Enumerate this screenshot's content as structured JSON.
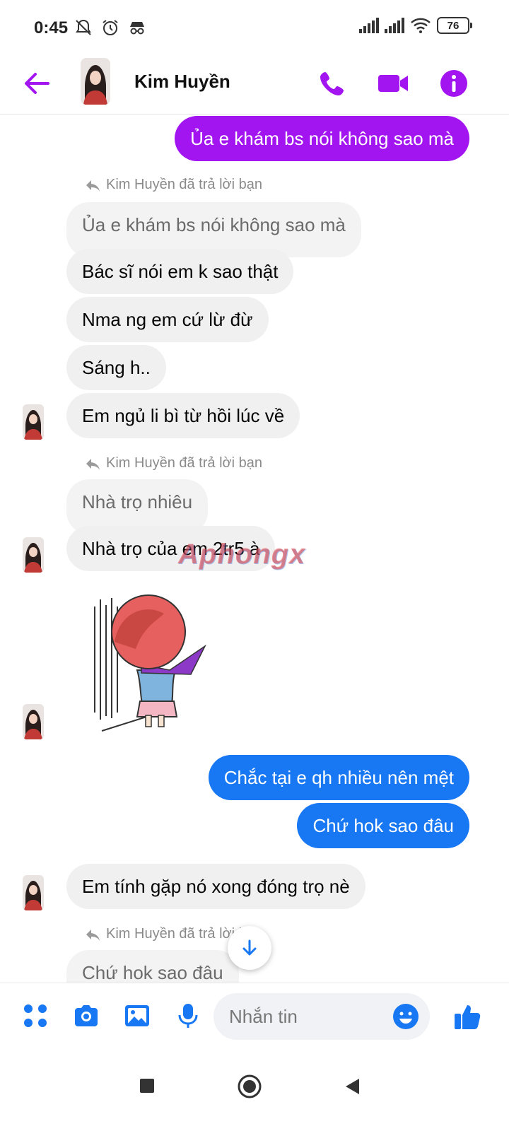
{
  "status_bar": {
    "time": "0:45",
    "battery": "76"
  },
  "header": {
    "contact_name": "Kim Huyền"
  },
  "messages": {
    "out_1": "Ủa e khám bs nói không sao mà",
    "reply_label_1": "Kim Huyền đã trả lời bạn",
    "quoted_1": "Ủa e khám bs nói không sao mà",
    "in_1": "Bác sĩ nói em k sao thật",
    "in_2": "Nma ng em cứ lừ đừ",
    "in_3": "Sáng h..",
    "in_4": "Em ngủ li bì từ hồi lúc về",
    "reply_label_2": "Kim Huyền đã trả lời bạn",
    "quoted_2": "Nhà trọ nhiêu",
    "in_5": "Nhà trọ của em 2tr5 à",
    "out_2": "Chắc tại e qh nhiều nên mệt",
    "out_3": "Chứ hok sao đâu",
    "in_6": "Em tính gặp nó xong đóng trọ nè",
    "reply_label_3": "Kim Huyền đã trả lời bạn",
    "quoted_3": "Chứ hok sao đâu"
  },
  "watermark": "Aphongx",
  "composer": {
    "placeholder": "Nhắn tin"
  },
  "colors": {
    "accent_purple": "#a214f0",
    "messenger_blue": "#1877f2",
    "incoming_gray": "#f0f0f0"
  },
  "icons": [
    "back-arrow-icon",
    "phone-icon",
    "video-icon",
    "info-icon",
    "apps-icon",
    "camera-icon",
    "gallery-icon",
    "mic-icon",
    "emoji-icon",
    "like-icon",
    "reply-icon",
    "arrow-down-icon"
  ]
}
